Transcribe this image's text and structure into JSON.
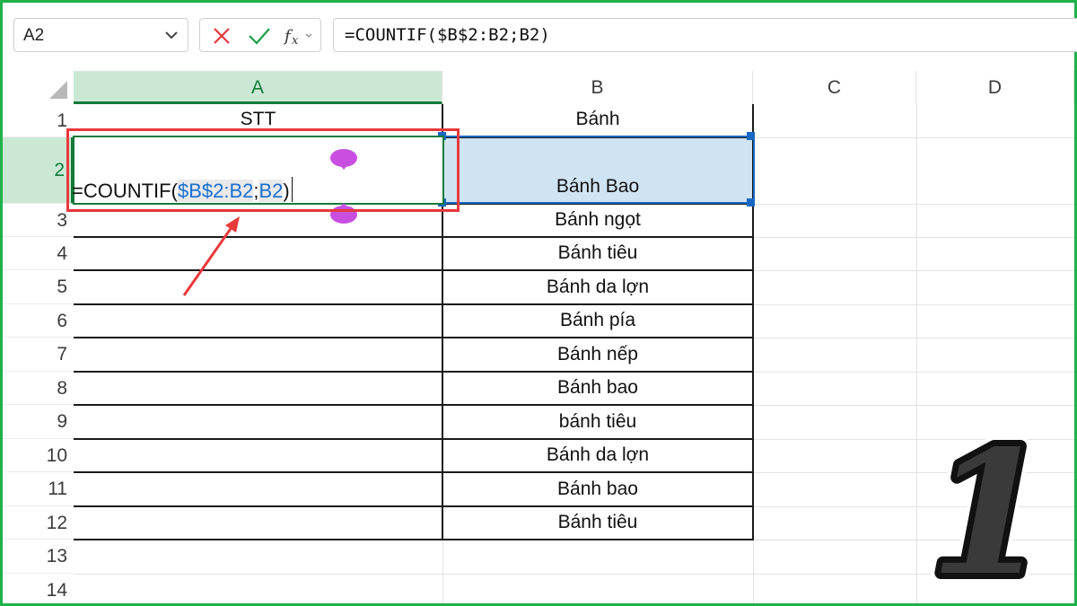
{
  "name_box": {
    "value": "A2"
  },
  "formula_bar": {
    "formula": "=COUNTIF($B$2:B2;B2)",
    "cancel_icon": "x-icon",
    "enter_icon": "check-icon",
    "function_icon": "fx-icon"
  },
  "columns": [
    "A",
    "B",
    "C",
    "D"
  ],
  "rows": [
    "1",
    "2",
    "3",
    "4",
    "5",
    "6",
    "7",
    "8",
    "9",
    "10",
    "11",
    "12",
    "13",
    "14"
  ],
  "cells": {
    "A1": "STT",
    "B": [
      "Bánh",
      "Bánh Bao",
      "Bánh ngọt",
      "Bánh tiêu",
      "Bánh da lợn",
      "Bánh pía",
      "Bánh nếp",
      "Bánh bao",
      "bánh tiêu",
      "Bánh da lợn",
      "Bánh bao",
      "Bánh tiêu"
    ]
  },
  "editing": {
    "prefix": "=COUNTIF(",
    "range": "$B$2:B2",
    "sep": ";",
    "crit": "B2",
    "suffix": ")"
  },
  "step_badge": "1",
  "colors": {
    "frame": "#1fb24a",
    "selected_header_bg": "#cbe8d5",
    "selected_header_text": "#147a3a",
    "reference_fill": "#cfe3f3",
    "reference_border": "#1769c2",
    "annotation_red": "#e8393b",
    "touch_handle": "#c94fe0"
  }
}
